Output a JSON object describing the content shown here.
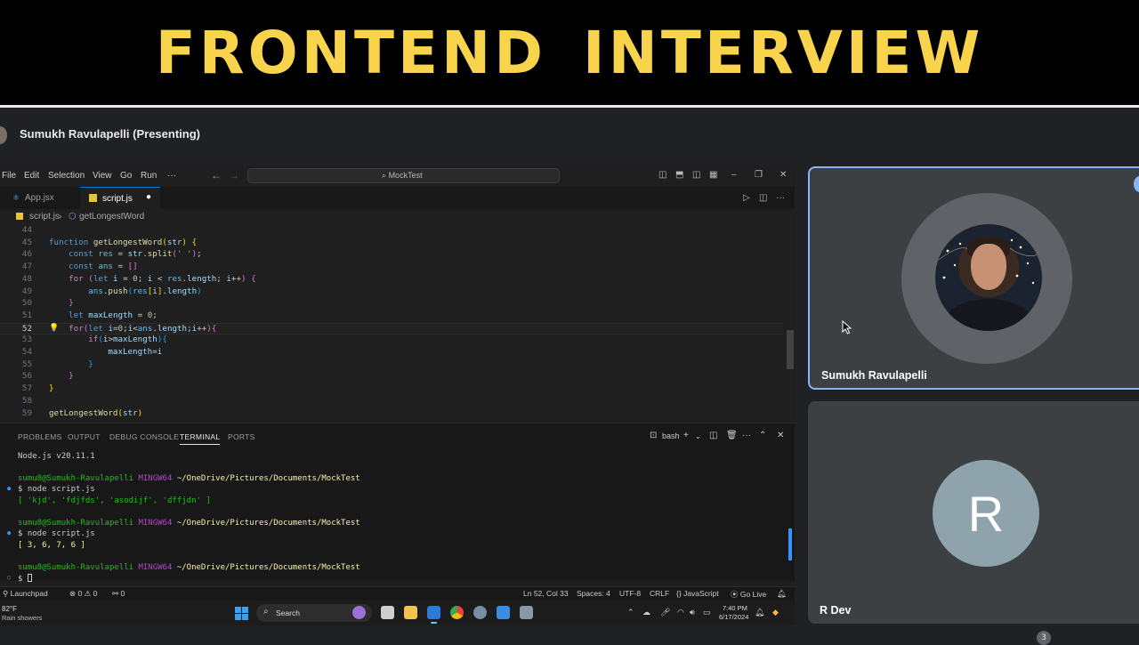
{
  "banner": {
    "title": "FRONTEND INTERVIEW"
  },
  "meet": {
    "presenter_label": "Sumukh Ravulapelli (Presenting)",
    "participants": [
      {
        "name": "Sumukh Ravulapelli"
      },
      {
        "name": "R Dev",
        "initial": "R"
      }
    ],
    "participant_count": "3"
  },
  "vscode": {
    "menu": [
      "File",
      "Edit",
      "Selection",
      "View",
      "Go",
      "Run",
      "···"
    ],
    "command_center": "MockTest",
    "tabs": [
      {
        "label": "App.jsx",
        "icon": "react-icon"
      },
      {
        "label": "script.js",
        "icon": "javascript-icon",
        "modified": true
      }
    ],
    "breadcrumb": {
      "file": "script.js",
      "symbol": "getLongestWord"
    },
    "lines": [
      "44",
      "45",
      "46",
      "47",
      "48",
      "49",
      "50",
      "51",
      "52",
      "53",
      "54",
      "55",
      "56",
      "57",
      "58",
      "59"
    ],
    "panel_tabs": [
      "PROBLEMS",
      "OUTPUT",
      "DEBUG CONSOLE",
      "TERMINAL",
      "PORTS"
    ],
    "terminal_shell": "bash",
    "terminal": {
      "version": "Node.js v20.11.1",
      "user": "sumu8@Sumukh-Ravulapelli",
      "env": "MINGW64",
      "path": "~/OneDrive/Pictures/Documents/MockTest",
      "cmd": "$ node script.js",
      "out1": "[ 'kjd', 'fdjfds', 'asodijf', 'dffjdn' ]",
      "out2": "[ 3, 6, 7, 6 ]",
      "prompt": "$"
    },
    "status": {
      "launchpad": "Launchpad",
      "errors": "0",
      "warnings": "0",
      "ports": "0",
      "position": "Ln 52, Col 33",
      "spaces": "Spaces: 4",
      "encoding": "UTF-8",
      "eol": "CRLF",
      "language": "JavaScript",
      "golive": "Go Live"
    }
  },
  "taskbar": {
    "weather_temp": "82°F",
    "weather_desc": "Rain showers",
    "search": "Search",
    "time": "7:40 PM",
    "date": "6/17/2024"
  },
  "colors": {
    "banner_text": "#f7d44b",
    "active_tile_border": "#8ab4f8",
    "vscode_accent": "#0078d4"
  }
}
